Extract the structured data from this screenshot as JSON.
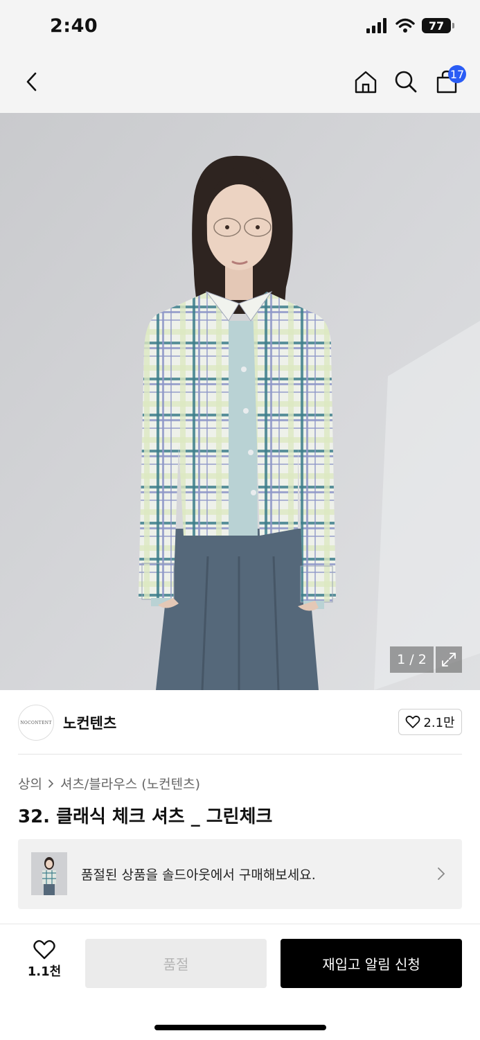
{
  "status_bar": {
    "time": "2:40",
    "battery": "77"
  },
  "nav": {
    "back_icon": "chevron-left-icon",
    "home_icon": "home-icon",
    "search_icon": "search-icon",
    "cart_icon": "shopping-bag-icon",
    "cart_count": "17"
  },
  "gallery": {
    "counter": "1 / 2",
    "expand_icon": "expand-icon"
  },
  "brand": {
    "logo_text": "NOCONTENT",
    "name": "노컨텐츠",
    "like_count": "2.1만"
  },
  "product": {
    "breadcrumb": [
      "상의",
      "셔츠/블라우스 (노컨텐츠)"
    ],
    "title": "32. 클래식 체크 셔츠 _ 그린체크"
  },
  "soldout_banner": {
    "text": "품절된 상품을 솔드아웃에서 구매해보세요."
  },
  "bottom_bar": {
    "wish_count": "1.1천",
    "soldout_label": "품절",
    "restock_label": "재입고 알림 신청"
  },
  "colors": {
    "badge": "#2a5cf5",
    "primary_button": "#000000",
    "disabled_button": "#ebebeb"
  }
}
